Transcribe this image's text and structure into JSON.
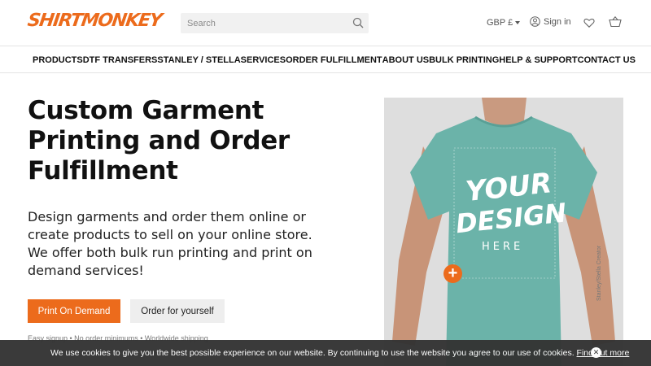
{
  "header": {
    "logo_text": "SHIRTMONKEY",
    "search_placeholder": "Search",
    "currency": "GBP £",
    "sign_in": "Sign in"
  },
  "nav": {
    "items": [
      {
        "label": "PRODUCTS"
      },
      {
        "label": "DTF TRANSFERS"
      },
      {
        "label": "STANLEY / STELLA"
      },
      {
        "label": "SERVICES"
      },
      {
        "label": "ORDER FULFILLMENT"
      },
      {
        "label": "ABOUT US"
      },
      {
        "label": "BULK PRINTING"
      },
      {
        "label": "HELP & SUPPORT"
      },
      {
        "label": "CONTACT US"
      }
    ]
  },
  "hero": {
    "title_line1": "Custom Garment",
    "title_line2": "Printing and Order",
    "title_line3": "Fulfillment",
    "subtitle": "Design garments and order them online or create products to sell on your online store. We offer both bulk run printing and print on demand services!",
    "primary_button": "Print On Demand",
    "secondary_button": "Order for yourself",
    "perks": "Easy signup • No order minimums • Worldwide shipping"
  },
  "product_image": {
    "design_line1": "YOUR",
    "design_line2": "DESIGN",
    "design_line3": "HERE",
    "credit": "Stanley/Stella Creator",
    "shirt_color": "#6bb3a9",
    "add_button": "+"
  },
  "cookie_banner": {
    "message": "We use cookies to give you the best possible experience on our website. By continuing to use the website you agree to our use of cookies.",
    "link": "Find out more",
    "close": "✕"
  },
  "colors": {
    "accent": "#ec6b1c",
    "banner_bg": "#333333"
  }
}
